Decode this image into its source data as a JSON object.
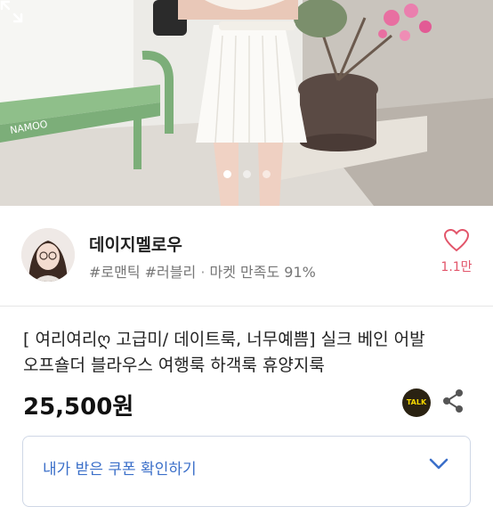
{
  "hero": {
    "brand_sign": "NAMOO",
    "page_dots": 3,
    "active_dot": 0
  },
  "seller": {
    "name": "데이지멜로우",
    "tags": "#로맨틱 #러블리",
    "separator": "·",
    "satisfaction": "마켓 만족도 91%",
    "like_count": "1.1만"
  },
  "product": {
    "title_line1": "[ 여리여리ღ 고급미/ 데이트룩, 너무예쁨] 실크 베인 어발",
    "title_line2": "오프숄더 블라우스  여행룩 하객룩 휴양지룩",
    "price": "25,500원"
  },
  "actions": {
    "talk_label": "TALK"
  },
  "coupon": {
    "label": "내가 받은 쿠폰 확인하기"
  },
  "colors": {
    "like": "#e2556a",
    "coupon_text": "#3b6fc9",
    "talk_bg": "#2a2212",
    "talk_text": "#f6d800"
  }
}
